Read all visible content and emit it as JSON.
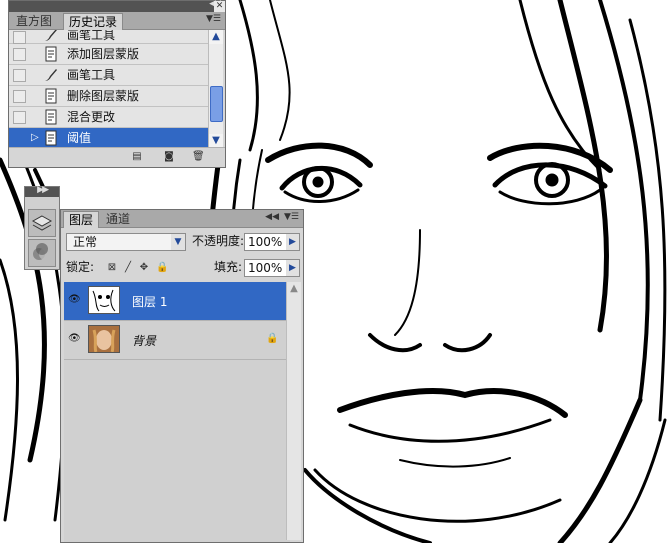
{
  "history_panel": {
    "tabs": [
      {
        "label": "直方图",
        "active": false
      },
      {
        "label": "历史记录",
        "active": true
      }
    ],
    "collapse_icon": "double-chevron-left-icon",
    "menu_icon": "panel-menu-icon",
    "items": [
      {
        "label": "画笔工具",
        "icon": "brush-icon",
        "selected": false
      },
      {
        "label": "添加图层蒙版",
        "icon": "history-state-icon",
        "selected": false
      },
      {
        "label": "画笔工具",
        "icon": "brush-icon",
        "selected": false
      },
      {
        "label": "删除图层蒙版",
        "icon": "history-state-icon",
        "selected": false
      },
      {
        "label": "混合更改",
        "icon": "history-state-icon",
        "selected": false
      },
      {
        "label": "阈值",
        "icon": "history-state-icon",
        "selected": true
      }
    ],
    "footer_icons": [
      "new-document-from-state-icon",
      "camera-snapshot-icon",
      "trash-icon"
    ],
    "selection_color": "#3168c4"
  },
  "dock": {
    "buttons": [
      "layers-icon",
      "channels-icon"
    ]
  },
  "layers_panel": {
    "tabs": [
      {
        "label": "图层",
        "active": true
      },
      {
        "label": "通道",
        "active": false
      }
    ],
    "blend_mode": "正常",
    "opacity_label": "不透明度:",
    "opacity_value": "100%",
    "lock_label": "锁定:",
    "fill_label": "填充:",
    "fill_value": "100%",
    "lock_icons": [
      "lock-transparent-icon",
      "lock-brush-icon",
      "lock-move-icon",
      "lock-all-icon"
    ],
    "layers": [
      {
        "name": "图层 1",
        "visible": true,
        "selected": true,
        "locked": false,
        "thumbnail": "sketch-thumbnail"
      },
      {
        "name": "背景",
        "visible": true,
        "selected": false,
        "locked": true,
        "thumbnail": "photo-thumbnail"
      }
    ]
  },
  "canvas": {
    "description_icon": "threshold-face-artwork"
  }
}
